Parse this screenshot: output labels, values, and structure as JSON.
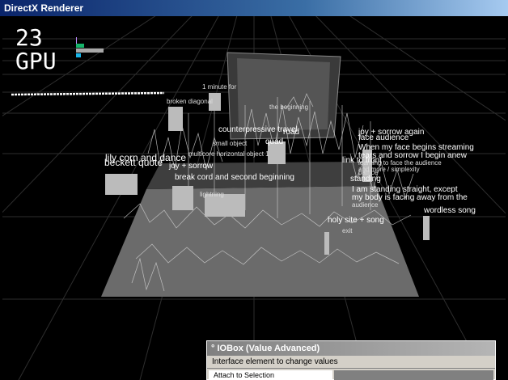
{
  "window": {
    "title": "DirectX Renderer"
  },
  "hud": {
    "fps": "23",
    "mode": "GPU"
  },
  "scene_labels": [
    {
      "text": "1 minute for",
      "size": "sm"
    },
    {
      "text": "broken diagonal",
      "size": "sm"
    },
    {
      "text": "the beginning",
      "size": "sm"
    },
    {
      "text": "counterpressive travel",
      "size": "md"
    },
    {
      "text": "road",
      "size": "md"
    },
    {
      "text": "quad",
      "size": "md"
    },
    {
      "text": "small object",
      "size": "sm"
    },
    {
      "text": "multicore horizontal object 1",
      "size": "sm"
    },
    {
      "text": "lily corn and dance",
      "size": "lg"
    },
    {
      "text": "beckett quote",
      "size": "lg"
    },
    {
      "text": "joy + sorrow",
      "size": "md"
    },
    {
      "text": "break cord and second beginning",
      "size": "md"
    },
    {
      "text": "joy + sorrow again",
      "size": "md"
    },
    {
      "text": "face audience",
      "size": "md"
    },
    {
      "text": "When my face begins streaming",
      "size": "md"
    },
    {
      "text": "tears and sorrow I begin anew",
      "size": "md"
    },
    {
      "text": "learning to face the audience",
      "size": "sm"
    },
    {
      "text": "and more / simplexity",
      "size": "sm"
    },
    {
      "text": "link to front",
      "size": "md"
    },
    {
      "text": "patrice",
      "size": "sm"
    },
    {
      "text": "standing",
      "size": "md"
    },
    {
      "text": "I am standing straight, except",
      "size": "md"
    },
    {
      "text": "my body is facing away from the",
      "size": "md"
    },
    {
      "text": "audience",
      "size": "sm"
    },
    {
      "text": "lightning",
      "size": "sm"
    },
    {
      "text": "holy site + song",
      "size": "md"
    },
    {
      "text": "wordless song",
      "size": "md"
    },
    {
      "text": "exit",
      "size": "sm"
    }
  ],
  "iobox": {
    "title": "° IOBox (Value Advanced)",
    "description": "Interface element to change values",
    "attach_label": "Attach to Selection"
  }
}
